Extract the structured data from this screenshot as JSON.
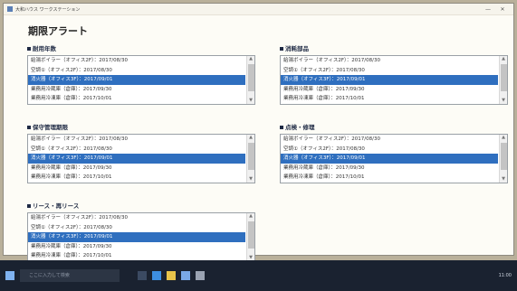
{
  "window": {
    "title": "大和ハウス ワークステーション",
    "min": "—",
    "close": "✕"
  },
  "page_title": "期限アラート",
  "items": [
    "給湯ボイラー（オフィス2F）：2017/08/30",
    "空調①（オフィス2F）：2017/08/30",
    "消火器（オフィス3F）：2017/09/01",
    "業務用冷蔵庫（倉庫）：2017/09/30",
    "業務用冷凍庫（倉庫）：2017/10/01"
  ],
  "sections": [
    {
      "label": "耐用年数"
    },
    {
      "label": "消耗部品"
    },
    {
      "label": "保守管理期限"
    },
    {
      "label": "点検・修理"
    },
    {
      "label": "リース・再リース"
    }
  ],
  "taskbar": {
    "search_placeholder": "ここに入力して検索",
    "clock": "11:00"
  },
  "colors": {
    "selected": "#2f6fbf",
    "title_bg": "#f6f4ec"
  }
}
